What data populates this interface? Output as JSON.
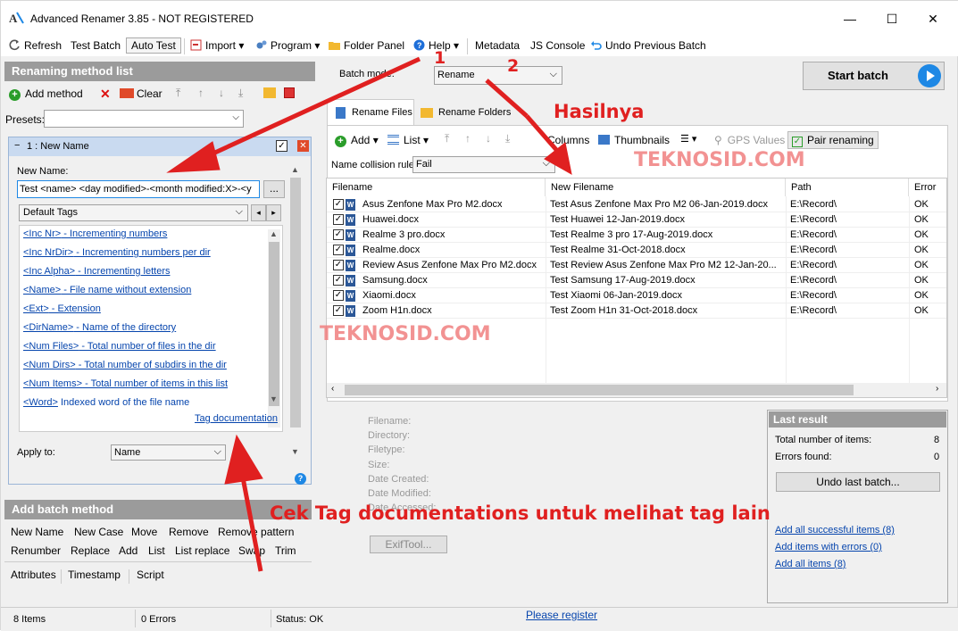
{
  "window": {
    "title": "Advanced Renamer 3.85 - NOT REGISTERED",
    "minimize": "—",
    "maximize": "☐",
    "close": "✕"
  },
  "toolbar": {
    "refresh": "Refresh",
    "test_batch": "Test Batch",
    "auto_test": "Auto Test",
    "import": "Import",
    "program": "Program",
    "folder_panel": "Folder Panel",
    "help": "Help",
    "metadata": "Metadata",
    "js_console": "JS Console",
    "undo_previous": "Undo Previous Batch"
  },
  "left": {
    "method_list_title": "Renaming method list",
    "add_method": "Add method",
    "clear": "Clear",
    "presets_label": "Presets:",
    "method_header": "1 : New Name",
    "new_name_label": "New Name:",
    "new_name_value": "Test <name> <day modified>-<month modified:X>-<y",
    "browse": "...",
    "tags_select": "Default Tags",
    "tags": [
      {
        "tag": "<Inc Nr>",
        "desc": " - Incrementing numbers"
      },
      {
        "tag": "<Inc NrDir>",
        "desc": " - Incrementing numbers per dir"
      },
      {
        "tag": "<Inc Alpha>",
        "desc": " - Incrementing letters"
      },
      {
        "tag": "<Name>",
        "desc": " - File name without extension"
      },
      {
        "tag": "<Ext>",
        "desc": " - Extension"
      },
      {
        "tag": "<DirName>",
        "desc": " - Name of the directory"
      },
      {
        "tag": "<Num Files>",
        "desc": " - Total number of files in the dir"
      },
      {
        "tag": "<Num Dirs>",
        "desc": " - Total number of subdirs in the dir"
      },
      {
        "tag": "<Num Items>",
        "desc": " - Total number of items in this list"
      },
      {
        "tag": "<Word>",
        "desc": " Indexed word of the file name"
      }
    ],
    "tag_doc": "Tag documentation",
    "apply_to_label": "Apply to:",
    "apply_to_value": "Name",
    "add_batch_title": "Add batch method",
    "batch_methods_row1": [
      "New Name",
      "New Case",
      "Move",
      "Remove",
      "Remove pattern"
    ],
    "batch_methods_row2": [
      "Renumber",
      "Replace",
      "Add",
      "List",
      "List replace",
      "Swap",
      "Trim"
    ],
    "batch_methods_row3": [
      "Attributes",
      "Timestamp",
      "Script"
    ]
  },
  "right": {
    "batch_mode_label": "Batch mode:",
    "batch_mode_value": "Rename",
    "start_batch": "Start batch",
    "tab_files": "Rename Files",
    "tab_folders": "Rename Folders",
    "add": "Add",
    "list": "List",
    "columns": "Columns",
    "thumbnails": "Thumbnails",
    "gps": "GPS Values",
    "pair": "Pair renaming",
    "collision_label": "Name collision rule:",
    "collision_value": "Fail",
    "columns_headers": [
      "Filename",
      "New Filename",
      "Path",
      "Error"
    ],
    "rows": [
      [
        "Asus Zenfone Max Pro M2.docx",
        "Test Asus Zenfone Max Pro M2 06-Jan-2019.docx",
        "E:\\Record\\",
        "OK"
      ],
      [
        "Huawei.docx",
        "Test Huawei 12-Jan-2019.docx",
        "E:\\Record\\",
        "OK"
      ],
      [
        "Realme 3 pro.docx",
        "Test Realme 3 pro 17-Aug-2019.docx",
        "E:\\Record\\",
        "OK"
      ],
      [
        "Realme.docx",
        "Test Realme 31-Oct-2018.docx",
        "E:\\Record\\",
        "OK"
      ],
      [
        "Review Asus Zenfone Max Pro M2.docx",
        "Test Review Asus Zenfone Max Pro M2 12-Jan-20...",
        "E:\\Record\\",
        "OK"
      ],
      [
        "Samsung.docx",
        "Test Samsung 17-Aug-2019.docx",
        "E:\\Record\\",
        "OK"
      ],
      [
        "Xiaomi.docx",
        "Test Xiaomi 06-Jan-2019.docx",
        "E:\\Record\\",
        "OK"
      ],
      [
        "Zoom H1n.docx",
        "Test Zoom H1n 31-Oct-2018.docx",
        "E:\\Record\\",
        "OK"
      ]
    ],
    "info_labels": [
      "Filename:",
      "Directory:",
      "Filetype:",
      "Size:",
      "Date Created:",
      "Date Modified:",
      "Date Accessed:"
    ],
    "exiftool": "ExifTool...",
    "last_result_title": "Last result",
    "total_label": "Total number of items:",
    "total_value": "8",
    "errors_label": "Errors found:",
    "errors_value": "0",
    "undo_last": "Undo last batch...",
    "add_successful": "Add all successful items (8)",
    "add_errors": "Add items with errors (0)",
    "add_all": "Add all items (8)"
  },
  "status": {
    "items": "8 Items",
    "errors": "0 Errors",
    "status": "Status: OK",
    "register": "Please register"
  },
  "annotations": {
    "num1": "1",
    "num2": "2",
    "hasilnya": "Hasilnya",
    "cek": "Cek Tag documentations untuk melihat tag lain",
    "watermark1": "TEKNOSID.COM",
    "watermark2": "TEKNOSID.COM"
  },
  "colors": {
    "annotation_red": "#e02020",
    "accent_blue": "#1e88e5",
    "panel_gray": "#9b9b9b"
  }
}
